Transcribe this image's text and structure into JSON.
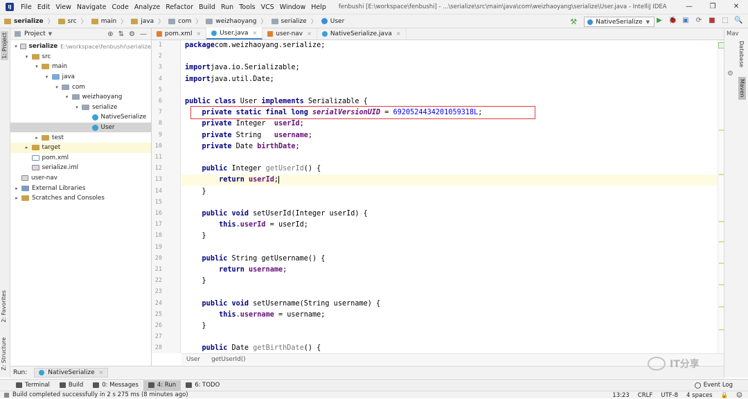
{
  "menubar": {
    "logo": "IJ",
    "items": [
      "File",
      "Edit",
      "View",
      "Navigate",
      "Code",
      "Analyze",
      "Refactor",
      "Build",
      "Run",
      "Tools",
      "VCS",
      "Window",
      "Help"
    ],
    "window_title": "fenbushi [E:\\workspace\\fenbushi] - ...\\serialize\\src\\main\\java\\com\\weizhaoyang\\serialize\\User.java - IntelliJ IDEA",
    "win_min": "—",
    "win_max": "❐",
    "win_close": "✕"
  },
  "navbar": {
    "crumbs": [
      "serialize",
      "src",
      "main",
      "java",
      "com",
      "weizhaoyang",
      "serialize",
      "User"
    ],
    "sep": "〉",
    "run_config": "NativeSerialize",
    "run_icon": "▶",
    "debug_icon": "🐞",
    "coverage_icon": "▣",
    "profile_icon": "⟳",
    "stop_icon": "■",
    "structure_icon": "⬚",
    "search_icon": "🔍"
  },
  "project": {
    "title": "Project",
    "tool_icons": [
      "⊕",
      "⇅",
      "⚙",
      "—"
    ],
    "tree": [
      {
        "label": "serialize",
        "path": "E:\\workspace\\fenbushi\\serialize",
        "depth": 0,
        "arrow": "▾",
        "icon": "mod",
        "bold": true
      },
      {
        "label": "src",
        "depth": 1,
        "arrow": "▾",
        "icon": "folder"
      },
      {
        "label": "main",
        "depth": 2,
        "arrow": "▾",
        "icon": "folder"
      },
      {
        "label": "java",
        "depth": 3,
        "arrow": "▾",
        "icon": "srcf"
      },
      {
        "label": "com",
        "depth": 4,
        "arrow": "▾",
        "icon": "pkg"
      },
      {
        "label": "weizhaoyang",
        "depth": 5,
        "arrow": "▾",
        "icon": "pkg"
      },
      {
        "label": "serialize",
        "depth": 6,
        "arrow": "▾",
        "icon": "pkg"
      },
      {
        "label": "NativeSerialize",
        "depth": 7,
        "arrow": "",
        "icon": "cls"
      },
      {
        "label": "User",
        "depth": 7,
        "arrow": "",
        "icon": "cls",
        "selected": true
      },
      {
        "label": "test",
        "depth": 2,
        "arrow": "▸",
        "icon": "folder"
      },
      {
        "label": "target",
        "depth": 1,
        "arrow": "▸",
        "icon": "folder",
        "highlight": true
      },
      {
        "label": "pom.xml",
        "depth": 1,
        "arrow": "",
        "icon": "xml"
      },
      {
        "label": "serialize.iml",
        "depth": 1,
        "arrow": "",
        "icon": "iml"
      },
      {
        "label": "user-nav",
        "depth": 0,
        "arrow": "",
        "icon": "mod"
      },
      {
        "label": "External Libraries",
        "depth": 0,
        "arrow": "▸",
        "icon": "lib"
      },
      {
        "label": "Scratches and Consoles",
        "depth": 0,
        "arrow": "▸",
        "icon": "scr"
      }
    ]
  },
  "tabs": [
    {
      "label": "pom.xml",
      "icon": "m",
      "active": false
    },
    {
      "label": "User.java",
      "icon": "c",
      "active": true
    },
    {
      "label": "user-nav",
      "icon": "m",
      "active": false
    },
    {
      "label": "NativeSerialize.java",
      "icon": "c",
      "active": false
    }
  ],
  "tab_close": "×",
  "editor": {
    "lines": [
      [
        [
          "kw",
          "package"
        ],
        [
          "",
          "com.weizhaoyang.serialize;"
        ]
      ],
      [],
      [
        [
          "kw",
          "import"
        ],
        [
          "",
          "java.io.Serializable;"
        ]
      ],
      [
        [
          "kw",
          "import"
        ],
        [
          "",
          "java.util.Date;"
        ]
      ],
      [],
      [
        [
          "kw",
          "public class"
        ],
        [
          "",
          " User "
        ],
        [
          "kw",
          "implements"
        ],
        [
          "",
          " Serializable {"
        ]
      ],
      [
        [
          "",
          "    "
        ],
        [
          "kw",
          "private static final long"
        ],
        [
          "",
          " "
        ],
        [
          "sfld",
          "serialVersionUID"
        ],
        [
          "",
          " = "
        ],
        [
          "num",
          "6920524434201059318L"
        ],
        [
          "",
          ";"
        ]
      ],
      [
        [
          "",
          "    "
        ],
        [
          "kw",
          "private"
        ],
        [
          "",
          " Integer  "
        ],
        [
          "fld",
          "userId"
        ],
        [
          "",
          ";"
        ]
      ],
      [
        [
          "",
          "    "
        ],
        [
          "kw",
          "private"
        ],
        [
          "",
          " String   "
        ],
        [
          "fld",
          "username"
        ],
        [
          "",
          ";"
        ]
      ],
      [
        [
          "",
          "    "
        ],
        [
          "kw",
          "private"
        ],
        [
          "",
          " Date "
        ],
        [
          "fld",
          "birthDate"
        ],
        [
          "",
          ";"
        ]
      ],
      [],
      [
        [
          "",
          "    "
        ],
        [
          "kw",
          "public"
        ],
        [
          "",
          " Integer "
        ],
        [
          "mth",
          "getUserId"
        ],
        [
          "",
          "() {"
        ]
      ],
      [
        [
          "",
          "        "
        ],
        [
          "kw",
          "return"
        ],
        [
          "",
          " "
        ],
        [
          "fld",
          "userId"
        ],
        [
          "",
          ";"
        ]
      ],
      [
        [
          "",
          "    }"
        ]
      ],
      [],
      [
        [
          "",
          "    "
        ],
        [
          "kw",
          "public void"
        ],
        [
          "",
          " setUserId(Integer userId) {"
        ]
      ],
      [
        [
          "",
          "        "
        ],
        [
          "kw",
          "this"
        ],
        [
          "",
          "."
        ],
        [
          "fld",
          "userId"
        ],
        [
          "",
          " = userId;"
        ]
      ],
      [
        [
          "",
          "    }"
        ]
      ],
      [],
      [
        [
          "",
          "    "
        ],
        [
          "kw",
          "public"
        ],
        [
          "",
          " String getUsername() {"
        ]
      ],
      [
        [
          "",
          "        "
        ],
        [
          "kw",
          "return"
        ],
        [
          "",
          " "
        ],
        [
          "fld",
          "username"
        ],
        [
          "",
          ";"
        ]
      ],
      [
        [
          "",
          "    }"
        ]
      ],
      [],
      [
        [
          "",
          "    "
        ],
        [
          "kw",
          "public void"
        ],
        [
          "",
          " setUsername(String username) {"
        ]
      ],
      [
        [
          "",
          "        "
        ],
        [
          "kw",
          "this"
        ],
        [
          "",
          "."
        ],
        [
          "fld",
          "username"
        ],
        [
          "",
          " = username;"
        ]
      ],
      [
        [
          "",
          "    }"
        ]
      ],
      [],
      [
        [
          "",
          "    "
        ],
        [
          "kw",
          "public"
        ],
        [
          "",
          " Date "
        ],
        [
          "mth",
          "getBirthDate"
        ],
        [
          "",
          "() {"
        ]
      ]
    ],
    "current_line": 13,
    "highlight_line": 7
  },
  "code_breadcrumb": [
    "User",
    "getUserId()"
  ],
  "left_strip": {
    "project": "1: Project",
    "favorites": "2: Favorites",
    "structure": "Z: Structure"
  },
  "right_strip": {
    "header": "Mav",
    "database": "Database",
    "maven": "Maven",
    "gear": "⚙"
  },
  "runbar": {
    "label": "Run:",
    "tab": "NativeSerialize"
  },
  "toolwindows": [
    {
      "label": "Terminal",
      "active": false
    },
    {
      "label": "Build",
      "active": false
    },
    {
      "label": "0: Messages",
      "active": false
    },
    {
      "label": "4: Run",
      "active": true
    },
    {
      "label": "6: TODO",
      "active": false
    }
  ],
  "event_log": "Event Log",
  "status": {
    "message": "Build completed successfully in 2 s 275 ms (8 minutes ago)",
    "position": "13:23",
    "line_sep": "CRLF",
    "encoding": "UTF-8",
    "indent": "4 spaces",
    "lock": "🔒",
    "face": "☺"
  },
  "watermark": "IT分享"
}
